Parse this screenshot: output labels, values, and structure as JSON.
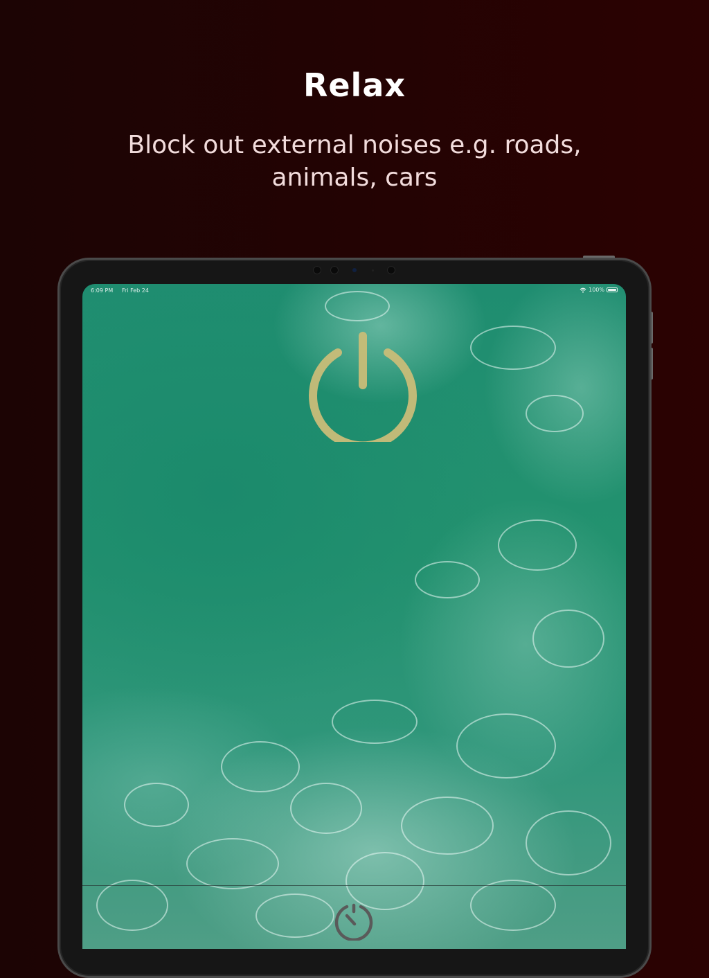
{
  "marketing": {
    "title": "Relax",
    "subtitle": "Block out external noises e.g. roads, animals, cars"
  },
  "status_bar": {
    "time": "6:09 PM",
    "date": "Fri Feb 24",
    "battery": "100%",
    "icons": [
      "wifi-icon",
      "battery-icon"
    ]
  },
  "app": {
    "main_icon": "power-icon",
    "bottom_icon": "timer-icon"
  },
  "colors": {
    "background": "#230303",
    "title": "#ffffff",
    "subtitle": "#f2dcdc",
    "power_icon": "#c9bd78",
    "timer_icon": "#5a5a5a",
    "water": "#1f8d70"
  }
}
